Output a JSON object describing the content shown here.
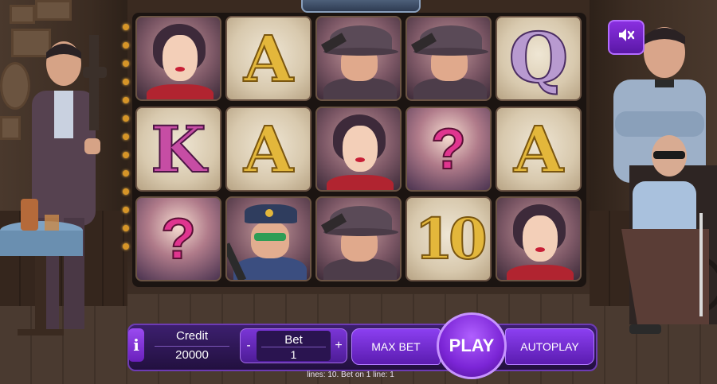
{
  "controls": {
    "info_label": "i",
    "credit_label": "Credit",
    "credit_value": "20000",
    "bet_label": "Bet",
    "bet_value": "1",
    "bet_minus": "-",
    "bet_plus": "+",
    "max_bet_label": "MAX BET",
    "play_label": "PLAY",
    "autoplay_label": "AUTOPLAY",
    "lines_info": "lines: 10.  Bet on 1 line: 1"
  },
  "sound": {
    "icon": "speaker-muted-icon",
    "muted": true
  },
  "reels": {
    "rows": [
      [
        "woman",
        "A",
        "gangster",
        "gangster",
        "Q"
      ],
      [
        "K",
        "A",
        "woman",
        "mystery",
        "A"
      ],
      [
        "mystery",
        "policeman",
        "gangster",
        "10",
        "woman"
      ]
    ],
    "symbols": {
      "A": "A",
      "K": "K",
      "Q": "Q",
      "10": "10",
      "mystery": "?"
    }
  },
  "colors": {
    "accent_purple": "#7b25d6",
    "gold": "#e3b73b",
    "magenta": "#e0358f"
  }
}
